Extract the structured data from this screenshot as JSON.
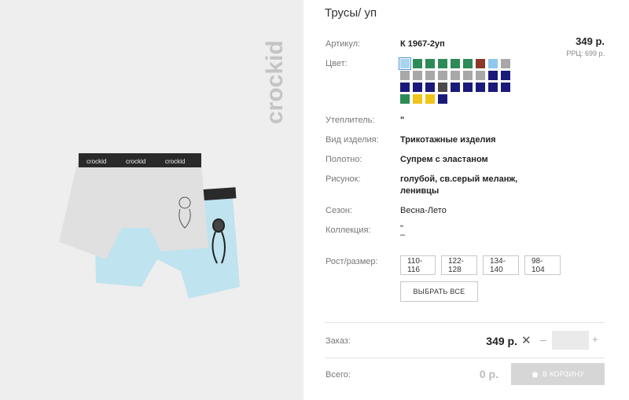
{
  "product": {
    "title": "Трусы/ уп",
    "brand": "crockid",
    "price": "349 р.",
    "rrp": "РРЦ: 699 р."
  },
  "specs": {
    "article_label": "Артикул:",
    "article_value": "К 1967-2уп",
    "color_label": "Цвет:",
    "insulation_label": "Утеплитель:",
    "insulation_value": "\"",
    "type_label": "Вид изделия:",
    "type_value": "Трикотажные изделия",
    "fabric_label": "Полотно:",
    "fabric_value": "Супрем с эластаном",
    "pattern_label": "Рисунок:",
    "pattern_value_line1": "голубой, св.серый меланж,",
    "pattern_value_line2": "ленивцы",
    "season_label": "Сезон:",
    "season_value": "Весна-Лето",
    "collection_label": "Коллекция:",
    "collection_value_line1": "\"",
    "collection_value_line2": "–"
  },
  "swatch_rows": [
    [
      "#a9d4ef",
      "#2e8b57",
      "#2e8b57",
      "#2e8b57",
      "#2e8b57",
      "#2e8b57",
      "#8b3a2a",
      "#8fc8ef",
      "#a8a8a8"
    ],
    [
      "#a8a8a8",
      "#a8a8a8",
      "#a8a8a8",
      "#a8a8a8",
      "#a8a8a8",
      "#a8a8a8",
      "#a8a8a8",
      "#1a1a7a",
      "#1a1a7a"
    ],
    [
      "#1a1a7a",
      "#1a1a7a",
      "#1a1a7a",
      "#4a4a4a",
      "#1a1a7a",
      "#1a1a7a",
      "#1a1a7a",
      "#1a1a7a",
      "#1a1a7a"
    ],
    [
      "#2e8b57",
      "#f0c419",
      "#f0c419",
      "#1a1a7a"
    ]
  ],
  "sizes": {
    "label": "Рост/размер:",
    "options": [
      "110-116",
      "122-128",
      "134-140",
      "98-104"
    ],
    "select_all": "ВЫБРАТЬ ВСЕ"
  },
  "order": {
    "label": "Заказ:",
    "price": "349 р.",
    "clear": "✕",
    "minus": "–",
    "plus": "+",
    "qty": ""
  },
  "total": {
    "label": "Всего:",
    "value": "0 р.",
    "cart_button": "В КОРЗИНУ"
  }
}
